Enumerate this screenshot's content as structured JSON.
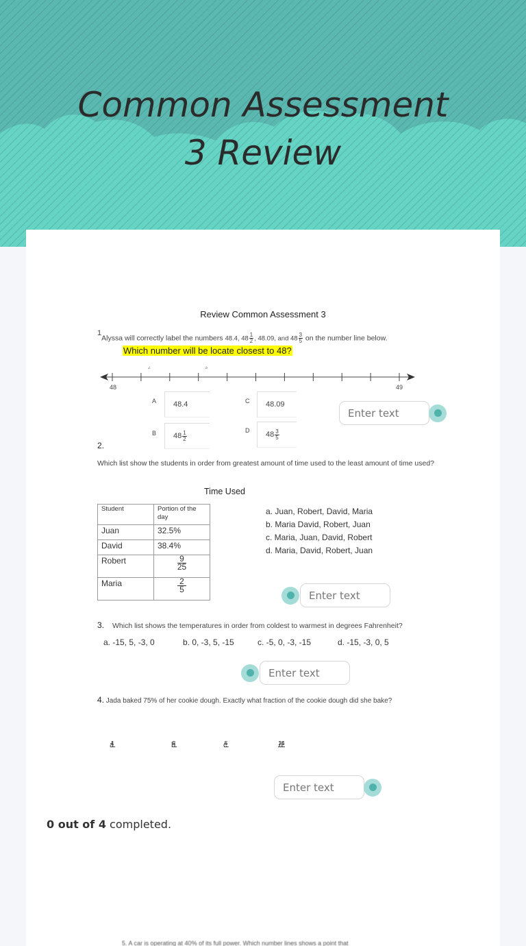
{
  "page": {
    "title": "Common Assessment 3 Review",
    "title_line1": "Common Assessment",
    "title_line2": "3 Review"
  },
  "colors": {
    "header_bg": "#5ab8b0",
    "cloud": "#66d3c3",
    "accent_dot": "#4fb3ab",
    "highlight": "#ffff00"
  },
  "document": {
    "heading": "Review Common Assessment 3",
    "q1": {
      "number": "1",
      "text_pre": "Alyssa will correctly label the numbers ",
      "values": "48.4, 48",
      "frac1_n": "1",
      "frac1_d": "2",
      "mid": ", 48.09, and 48",
      "frac2_n": "3",
      "frac2_d": "5",
      "text_post": " on the number line below.",
      "highlight": "Which number will be locate closest to 48?",
      "number_line": {
        "start": "48",
        "end": "49",
        "ticks": 11,
        "top_marks": [
          "2",
          "3"
        ]
      },
      "options": [
        {
          "letter": "A",
          "value": "48.4"
        },
        {
          "letter": "B",
          "whole": "48",
          "n": "1",
          "d": "2"
        },
        {
          "letter": "C",
          "value": "48.09"
        },
        {
          "letter": "D",
          "whole": "48",
          "n": "3",
          "d": "5"
        }
      ],
      "answer_placeholder": "Enter text"
    },
    "q2": {
      "number": "2.",
      "text": "Which list show the students in order from greatest amount of time used to the least amount of time used?",
      "table_title": "Time Used",
      "table_headers": [
        "Student",
        "Portion of the day"
      ],
      "rows": [
        {
          "student": "Juan",
          "portion": "32.5%"
        },
        {
          "student": "David",
          "portion": "38.4%"
        },
        {
          "student": "Robert",
          "n": "9",
          "d": "25"
        },
        {
          "student": "Maria",
          "n": "2",
          "d": "5"
        }
      ],
      "choices": [
        "a.  Juan, Robert, David, Maria",
        "b.  Maria David, Robert, Juan",
        "c.  Maria, Juan, David, Robert",
        "d.  Maria, David, Robert, Juan"
      ],
      "answer_placeholder": "Enter text"
    },
    "q3": {
      "number": "3.",
      "text": "Which list shows the temperatures in order from coldest to warmest in degrees Fahrenheit?",
      "choices": [
        "a.  -15, 5, -3, 0",
        "b. 0, -3, 5, -15",
        "c. -5, 0, -3, -15",
        "d. -15, -3, 0, 5"
      ],
      "answer_placeholder": "Enter text"
    },
    "q4": {
      "number": "4.",
      "text": " Jada baked 75% of her cookie dough. Exactly what fraction of the cookie dough did she bake?",
      "choices": [
        {
          "label": "a.",
          "n": "1",
          "d": "4"
        },
        {
          "label": "b.",
          "n": "2",
          "d": "5"
        },
        {
          "label": "c.",
          "n": "5",
          "d": "6"
        },
        {
          "label": "d.",
          "n": "14",
          "d": "25"
        }
      ],
      "answer_placeholder": "Enter text"
    },
    "q5_partial": "5.    A car is operating at 40% of its full power. Which number lines shows a point that"
  },
  "progress": {
    "done": "0 out of 4",
    "suffix": " completed."
  }
}
